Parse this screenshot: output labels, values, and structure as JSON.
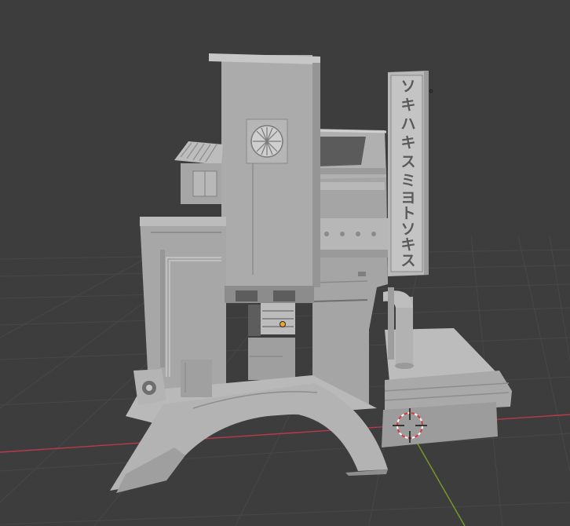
{
  "app": "3D Viewport",
  "colors": {
    "background": "#3d3d3d",
    "grid": "#4b4b4b",
    "x_axis": "#b83a4d",
    "y_axis": "#7a9a2a",
    "model": "#a8a8a8",
    "model_shadow": "#8e8e8e",
    "model_light": "#bdbdbd",
    "origin_point": "#f2a52d"
  },
  "icons": {
    "cursor": "3d-cursor-icon",
    "origin": "object-origin-icon",
    "light": "light-object-icon"
  },
  "sign": {
    "column_right": [
      "ソ",
      "キ",
      "ハ",
      "キ",
      "ス",
      "ミ"
    ],
    "column_left": [
      "ヨ",
      "ト",
      "ソ",
      "キ",
      "ス"
    ]
  }
}
